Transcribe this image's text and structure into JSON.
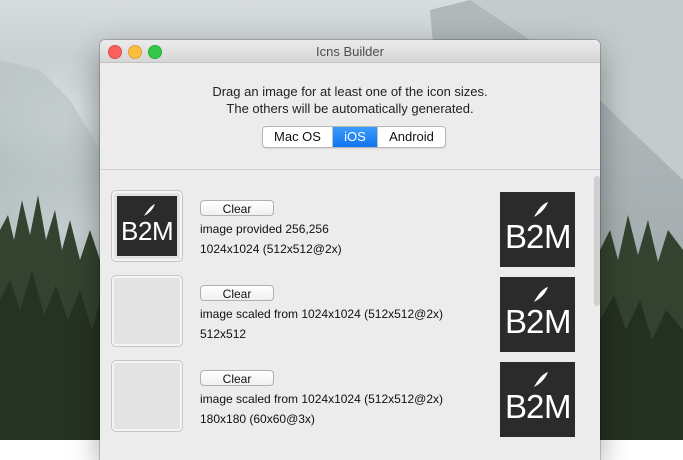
{
  "window": {
    "title": "Icns Builder"
  },
  "header": {
    "instruction_line1": "Drag an image for at least one of the icon sizes.",
    "instruction_line2": "The others will be automatically generated.",
    "platforms": [
      {
        "label": "Mac OS",
        "selected": false
      },
      {
        "label": "iOS",
        "selected": true
      },
      {
        "label": "Android",
        "selected": false
      }
    ]
  },
  "logo": {
    "text_left": "B",
    "text_mid": "2",
    "text_right": "M",
    "color_bg": "#2b2b2b",
    "color_fg": "#ffffff"
  },
  "rows": [
    {
      "clear_label": "Clear",
      "status": "image provided 256,256",
      "size": "1024x1024 (512x512@2x)",
      "has_source_image": true
    },
    {
      "clear_label": "Clear",
      "status": "image scaled from 1024x1024 (512x512@2x)",
      "size": "512x512",
      "has_source_image": false
    },
    {
      "clear_label": "Clear",
      "status": "image scaled from 1024x1024 (512x512@2x)",
      "size": "180x180 (60x60@3x)",
      "has_source_image": false
    }
  ]
}
